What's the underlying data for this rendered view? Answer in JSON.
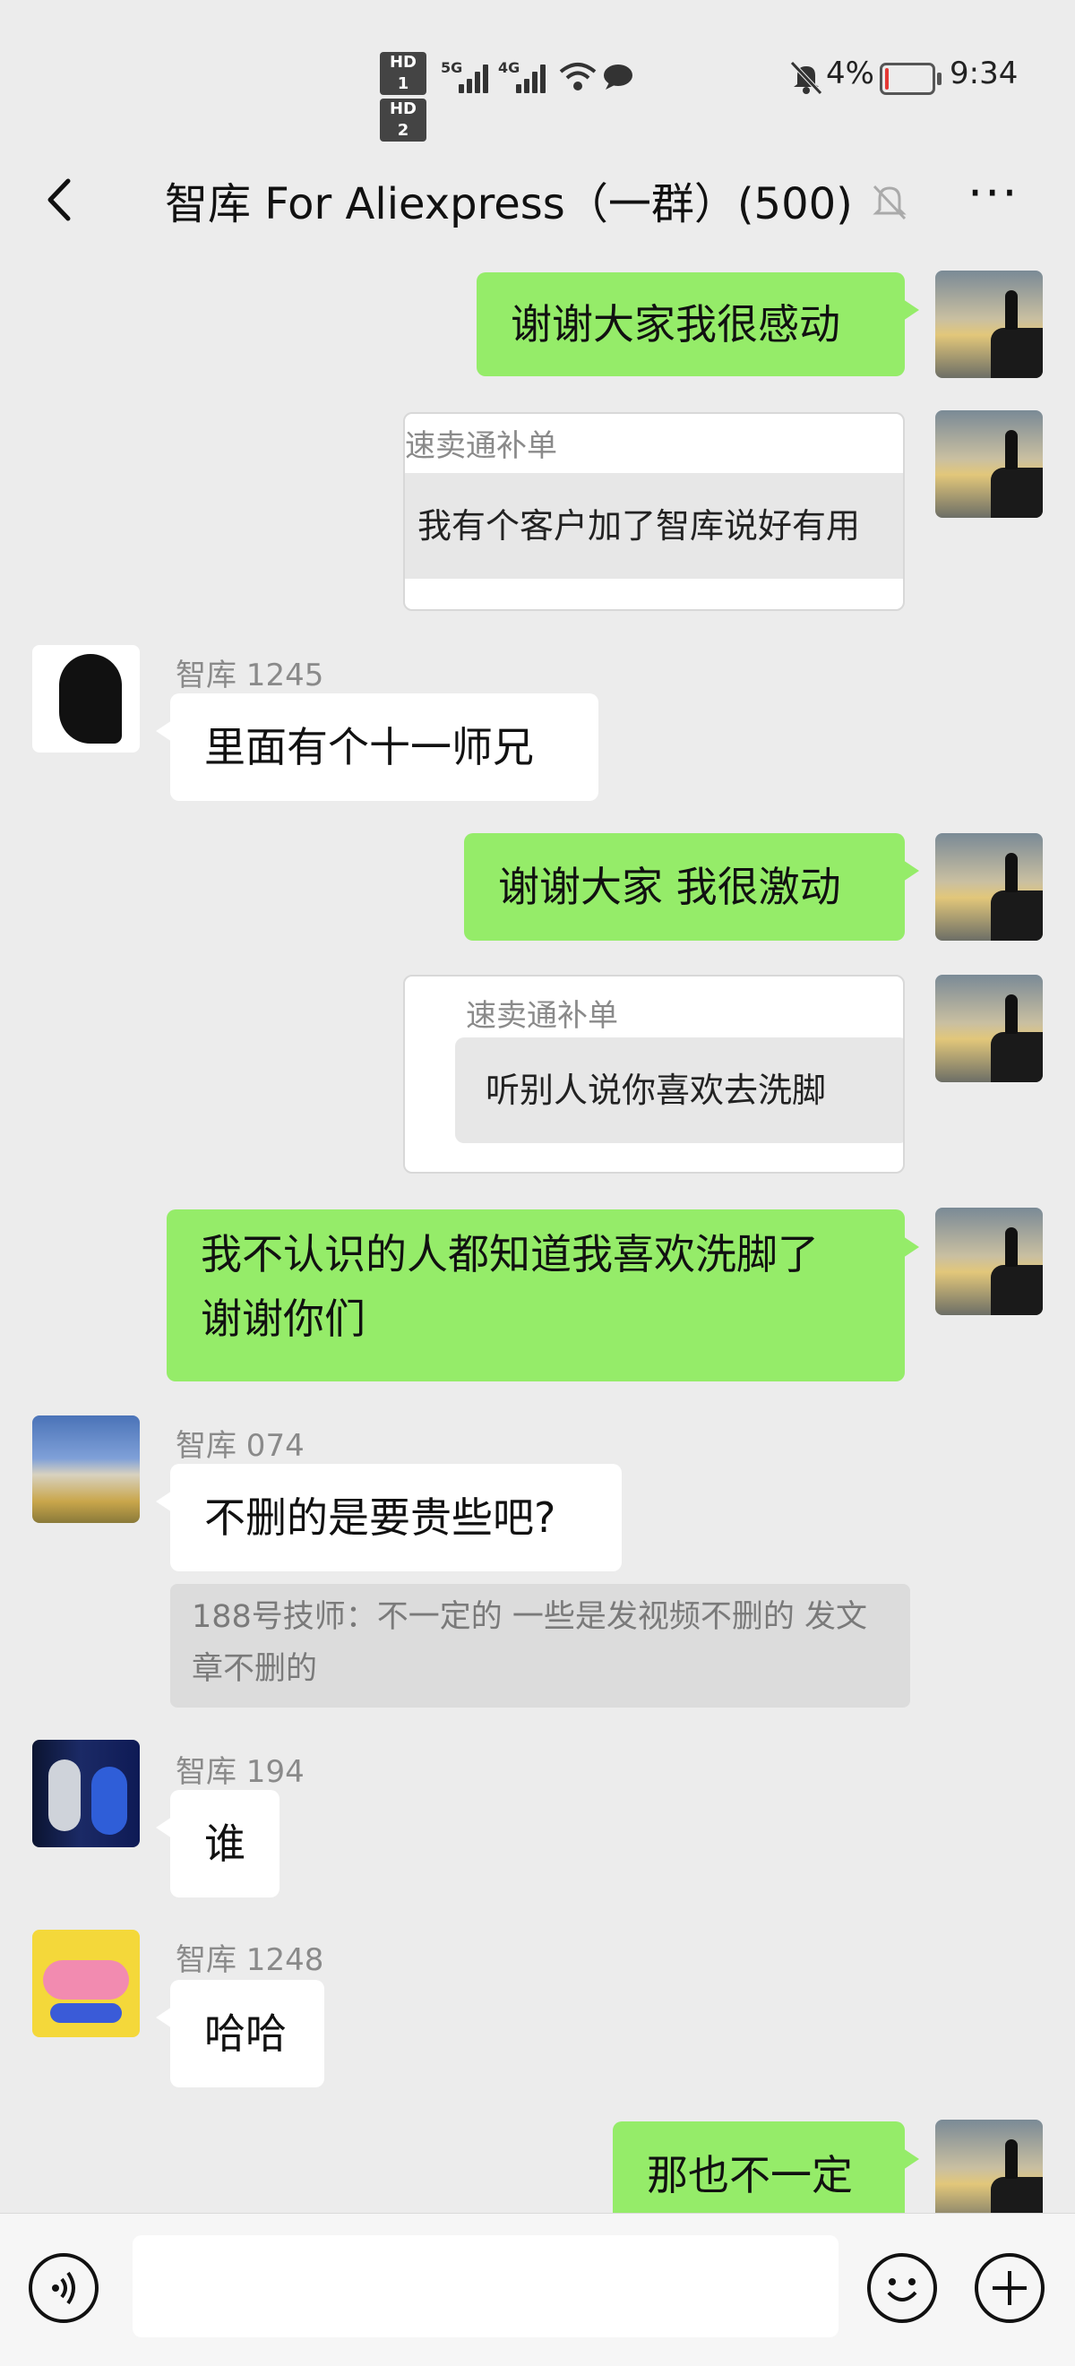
{
  "status_bar": {
    "hd1": "HD 1",
    "hd2": "HD 2",
    "net1": "5G",
    "net2": "4G",
    "battery": "4%",
    "time": "9:34"
  },
  "header": {
    "title": "智库 For Aliexpress（一群）(500)"
  },
  "messages": {
    "m1": "谢谢大家我很感动",
    "m2_title": "速卖通补单",
    "m2_body": "我有个客户加了智库说好有用",
    "m3_sender": "智库 1245",
    "m3": "里面有个十一师兄",
    "m4": "谢谢大家 我很激动",
    "m5_title": "速卖通补单",
    "m5_body": "听别人说你喜欢去洗脚",
    "m6": "我不认识的人都知道我喜欢洗脚了 谢谢你们",
    "m7_sender": "智库 074",
    "m7": "不删的是要贵些吧?",
    "m7_quote": "188号技师：不一定的 一些是发视频不删的 发文章不删的",
    "m8_sender": "智库 194",
    "m8": "谁",
    "m9_sender": "智库 1248",
    "m9": "哈哈",
    "m10": "那也不一定"
  },
  "colors": {
    "self_bubble": "#95ec69",
    "other_bubble": "#ffffff",
    "background": "#ececec"
  },
  "icons": {
    "back": "chevron-left-icon",
    "mute": "bell-off-icon",
    "more": "more-dots-icon",
    "voice": "voice-icon",
    "emoji": "emoji-icon",
    "plus": "plus-icon"
  }
}
